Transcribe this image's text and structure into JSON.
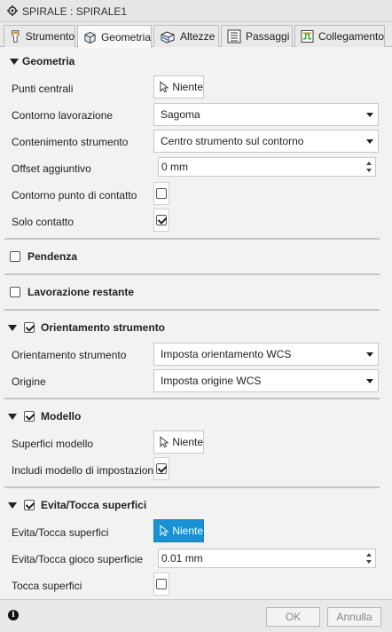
{
  "window": {
    "title": "SPIRALE : SPIRALE1"
  },
  "tabs": [
    {
      "label": "Strumento",
      "icon": "tool-icon"
    },
    {
      "label": "Geometria",
      "icon": "geometry-cube-icon"
    },
    {
      "label": "Altezze",
      "icon": "heights-icon"
    },
    {
      "label": "Passaggi",
      "icon": "passes-icon"
    },
    {
      "label": "Collegamento",
      "icon": "linking-icon"
    }
  ],
  "geometria": {
    "title": "Geometria",
    "punti_centrali": {
      "label": "Punti centrali",
      "value": "Niente"
    },
    "contorno_lavorazione": {
      "label": "Contorno lavorazione",
      "value": "Sagoma"
    },
    "contenimento_strumento": {
      "label": "Contenimento strumento",
      "value": "Centro strumento sul contorno"
    },
    "offset_aggiuntivo": {
      "label": "Offset aggiuntivo",
      "value": "0 mm"
    },
    "contorno_punto_contatto": {
      "label": "Contorno punto di contatto",
      "checked": false
    },
    "solo_contatto": {
      "label": "Solo contatto",
      "checked": true
    }
  },
  "pendenza": {
    "title": "Pendenza",
    "checked": false
  },
  "lavorazione_restante": {
    "title": "Lavorazione restante",
    "checked": false
  },
  "orientamento": {
    "title": "Orientamento strumento",
    "checked": true,
    "orientamento_strumento": {
      "label": "Orientamento strumento",
      "value": "Imposta orientamento WCS"
    },
    "origine": {
      "label": "Origine",
      "value": "Imposta origine WCS"
    }
  },
  "modello": {
    "title": "Modello",
    "checked": true,
    "superfici_modello": {
      "label": "Superfici modello",
      "value": "Niente"
    },
    "includi_modello": {
      "label": "Includi modello di impostazione",
      "checked": true
    }
  },
  "evita": {
    "title": "Evita/Tocca superfici",
    "checked": true,
    "evita_superfici": {
      "label": "Evita/Tocca superfici",
      "value": "Niente"
    },
    "gioco": {
      "label": "Evita/Tocca gioco superficie",
      "value": "0.01 mm"
    },
    "tocca": {
      "label": "Tocca superfici",
      "checked": false
    }
  },
  "footer": {
    "info": "i",
    "ok": "OK",
    "annulla": "Annulla"
  },
  "colors": {
    "accent": "#1992d4",
    "panel": "#f2f2f2"
  }
}
